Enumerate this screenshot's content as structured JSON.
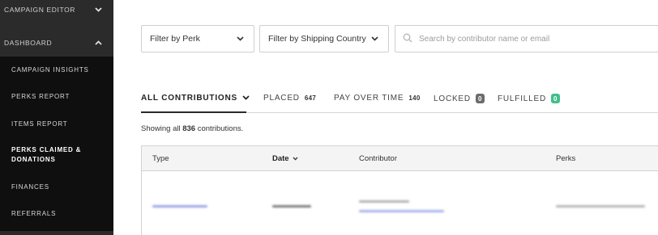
{
  "sidebar": {
    "sections": [
      {
        "label": "CAMPAIGN EDITOR",
        "expanded": false
      },
      {
        "label": "DASHBOARD",
        "expanded": true
      }
    ],
    "items": [
      {
        "label": "CAMPAIGN INSIGHTS",
        "active": false
      },
      {
        "label": "PERKS REPORT",
        "active": false
      },
      {
        "label": "ITEMS REPORT",
        "active": false
      },
      {
        "label": "PERKS CLAIMED & DONATIONS",
        "active": true
      },
      {
        "label": "FINANCES",
        "active": false
      },
      {
        "label": "REFERRALS",
        "active": false
      }
    ]
  },
  "filters": {
    "perk": {
      "label": "Filter by Perk",
      "icon": "chevron-down-icon"
    },
    "country": {
      "label": "Filter by Shipping Country",
      "icon": "chevron-down-icon"
    },
    "search": {
      "placeholder": "Search by contributor name or email",
      "icon": "search-icon"
    }
  },
  "tabs": [
    {
      "label": "ALL CONTRIBUTIONS",
      "count": "",
      "active": true
    },
    {
      "label": "PLACED",
      "count": "647",
      "active": false
    },
    {
      "label": "PAY OVER TIME",
      "count": "140",
      "active": false
    },
    {
      "label": "LOCKED",
      "count": "0",
      "active": false,
      "pill_color": "#6b6b6b"
    },
    {
      "label": "FULFILLED",
      "count": "0",
      "active": false,
      "pill_color": "#3fc08b"
    }
  ],
  "summary": {
    "prefix": "Showing all",
    "count": "836",
    "suffix": "contributions."
  },
  "table": {
    "columns": [
      "Type",
      "Date",
      "Contributor",
      "Perks"
    ],
    "sorted_column": "Date"
  },
  "colors": {
    "sidebar_bg": "#2b2b2b",
    "sidebar_sub_bg": "#0f0f0f",
    "locked_pill": "#6b6b6b",
    "fulfilled_pill": "#3fc08b",
    "table_header_bg": "#f4f4f4"
  }
}
